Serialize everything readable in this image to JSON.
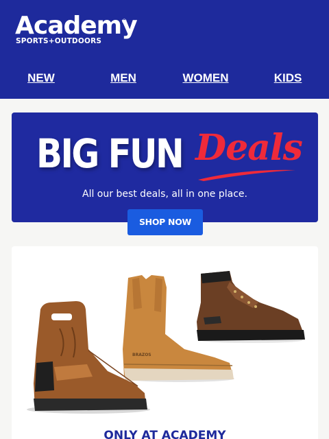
{
  "header": {
    "logo_text": "Academy",
    "logo_registered": "®",
    "logo_tagline": "SPORTS+OUTDOORS",
    "nav": [
      {
        "label": "NEW"
      },
      {
        "label": "MEN"
      },
      {
        "label": "WOMEN"
      },
      {
        "label": "KIDS"
      }
    ]
  },
  "hero": {
    "headline": "BIG FUN",
    "headline_script": "Deals",
    "subtitle": "All our best deals, all in one place.",
    "button_label": "SHOP NOW"
  },
  "product_card": {
    "title": "ONLY AT ACADEMY",
    "boot_brand_text": "BRAZOS"
  },
  "colors": {
    "brand_blue": "#1e2a9c",
    "deals_red": "#ef2a3a",
    "button_blue": "#1a5ce0"
  }
}
